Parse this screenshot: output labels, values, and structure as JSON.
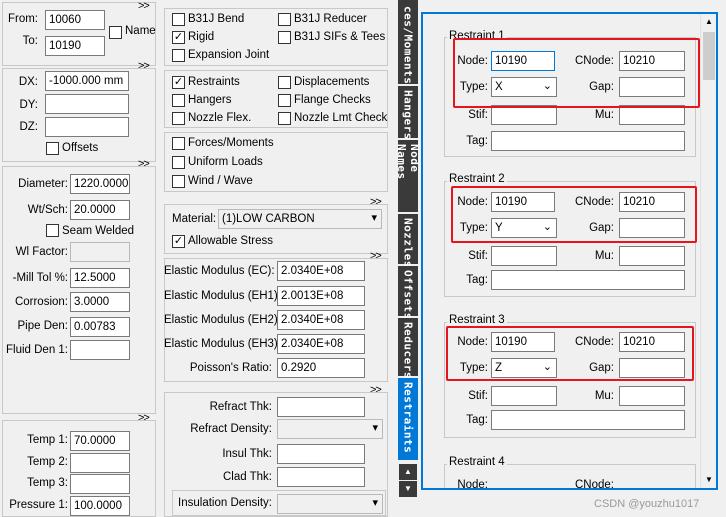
{
  "collapse_glyph": ">>",
  "node": {
    "from_label": "From:",
    "from_value": "10060",
    "to_label": "To:",
    "to_value": "10190",
    "name_label": "Name"
  },
  "delta": {
    "dx_label": "DX:",
    "dx_value": "-1000.000 mm",
    "dy_label": "DY:",
    "dy_value": "",
    "dz_label": "DZ:",
    "dz_value": "",
    "offsets_label": "Offsets"
  },
  "pipe": {
    "diameter_label": "Diameter:",
    "diameter_value": "1220.0000",
    "wtsch_label": "Wt/Sch:",
    "wtsch_value": "20.0000",
    "seam_label": "Seam Welded",
    "wlfactor_label": "Wl Factor:",
    "wlfactor_value": "",
    "milltol_label": "-Mill Tol %:",
    "milltol_value": "12.5000",
    "corrosion_label": "Corrosion:",
    "corrosion_value": "3.0000",
    "pipeden_label": "Pipe Den:",
    "pipeden_value": "0.00783",
    "fluidden_label": "Fluid Den 1:",
    "fluidden_value": ""
  },
  "temps": {
    "t1_label": "Temp 1:",
    "t1_value": "70.0000",
    "t2_label": "Temp 2:",
    "t2_value": "",
    "t3_label": "Temp 3:",
    "t3_value": "",
    "p1_label": "Pressure 1:",
    "p1_value": "100.0000"
  },
  "options_a": {
    "b31j_bend": "B31J Bend",
    "b31j_reducer": "B31J Reducer",
    "rigid": "Rigid",
    "b31j_sifs": "B31J SIFs & Tees",
    "expansion_joint": "Expansion Joint"
  },
  "options_b": {
    "restraints": "Restraints",
    "displacements": "Displacements",
    "hangers": "Hangers",
    "flange_checks": "Flange Checks",
    "nozzle_flex": "Nozzle Flex.",
    "nozzle_lmt": "Nozzle Lmt Check"
  },
  "options_c": {
    "forces": "Forces/Moments",
    "uniform": "Uniform Loads",
    "wind": "Wind / Wave"
  },
  "material": {
    "label": "Material:",
    "value": "(1)LOW CARBON",
    "allowable": "Allowable Stress"
  },
  "elastic": {
    "ec_label": "Elastic Modulus (EC):",
    "ec_value": "2.0340E+08",
    "eh1_label": "Elastic Modulus (EH1):",
    "eh1_value": "2.0013E+08",
    "eh2_label": "Elastic Modulus (EH2):",
    "eh2_value": "2.0340E+08",
    "eh3_label": "Elastic Modulus (EH3):",
    "eh3_value": "2.0340E+08",
    "poisson_label": "Poisson's Ratio:",
    "poisson_value": "0.2920"
  },
  "refract": {
    "thk_label": "Refract Thk:",
    "thk_value": "",
    "density_label": "Refract Density:",
    "density_value": "",
    "insul_label": "Insul Thk:",
    "insul_value": "",
    "clad_label": "Clad Thk:",
    "clad_value": "",
    "insdens_label": "Insulation Density:",
    "insdens_value": ""
  },
  "side_tabs": [
    "ces/Moments",
    "Hangers",
    "Node Names",
    "Nozzles",
    "Offsets",
    "Reducers",
    "Restraints"
  ],
  "restraints": [
    {
      "title": "Restraint 1",
      "node_label": "Node:",
      "node": "10190",
      "cnode_label": "CNode:",
      "cnode": "10210",
      "type_label": "Type:",
      "type": "X",
      "gap_label": "Gap:",
      "gap": "",
      "stif_label": "Stif:",
      "stif": "",
      "mu_label": "Mu:",
      "mu": "",
      "tag_label": "Tag:",
      "tag": ""
    },
    {
      "title": "Restraint 2",
      "node_label": "Node:",
      "node": "10190",
      "cnode_label": "CNode:",
      "cnode": "10210",
      "type_label": "Type:",
      "type": "Y",
      "gap_label": "Gap:",
      "gap": "",
      "stif_label": "Stif:",
      "stif": "",
      "mu_label": "Mu:",
      "mu": "",
      "tag_label": "Tag:",
      "tag": ""
    },
    {
      "title": "Restraint 3",
      "node_label": "Node:",
      "node": "10190",
      "cnode_label": "CNode:",
      "cnode": "10210",
      "type_label": "Type:",
      "type": "Z",
      "gap_label": "Gap:",
      "gap": "",
      "stif_label": "Stif:",
      "stif": "",
      "mu_label": "Mu:",
      "mu": "",
      "tag_label": "Tag:",
      "tag": ""
    },
    {
      "title": "Restraint 4",
      "node_label": "Node:",
      "cnode_label": "CNode:"
    }
  ],
  "watermark": "CSDN @youzhu1017",
  "colors": {
    "highlight": "#e4151c",
    "tab_bg": "#3a3a3a",
    "active_tab": "#0078d7",
    "form_border": "#0078d7"
  }
}
